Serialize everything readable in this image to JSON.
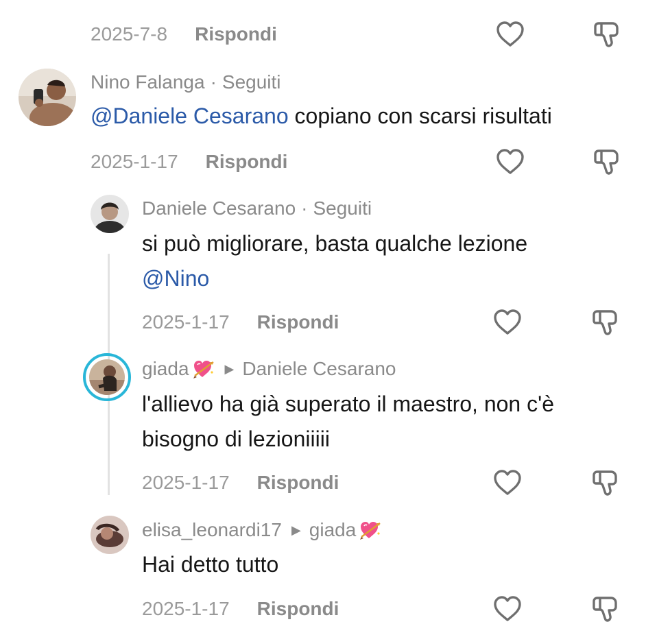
{
  "comments": [
    {
      "date": "2025-7-8",
      "reply_label": "Rispondi"
    },
    {
      "author": "Nino Falanga",
      "separator": "·",
      "relation": "Seguiti",
      "mention": "@Daniele Cesarano",
      "text": " copiano con scarsi risultati",
      "date": "2025-1-17",
      "reply_label": "Rispondi"
    },
    {
      "author": "Daniele Cesarano",
      "separator": "·",
      "relation": "Seguiti",
      "text": "si può migliorare, basta qualche lezione",
      "mention": "@Nino",
      "date": "2025-1-17",
      "reply_label": "Rispondi"
    },
    {
      "author": "giada",
      "reply_to": "Daniele Cesarano",
      "text_line1": "l'allievo ha già superato il maestro, non c'è",
      "text_line2": "bisogno di lezioniiiii",
      "date": "2025-1-17",
      "reply_label": "Rispondi"
    },
    {
      "author": "elisa_leonardi17",
      "reply_to": "giada",
      "text": "Hai detto tutto",
      "date": "2025-1-17",
      "reply_label": "Rispondi"
    }
  ],
  "colors": {
    "mention": "#2b5aa8",
    "meta": "#9a9a9a",
    "icon": "#6f6f6f",
    "story_ring": "#29b6d8"
  },
  "icons": [
    "heart-outline-icon",
    "thumbs-down-icon",
    "sparkling-heart-arrow-emoji",
    "reply-arrow-icon"
  ]
}
